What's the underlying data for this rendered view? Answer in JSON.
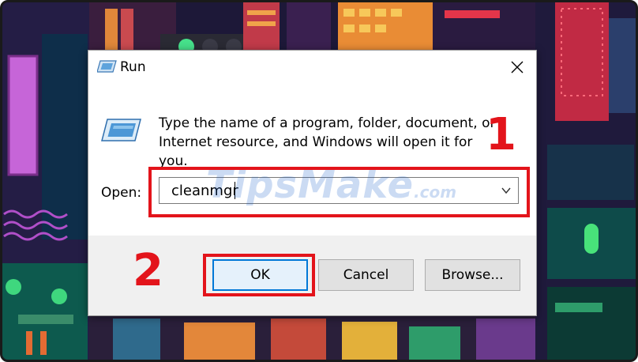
{
  "dialog": {
    "title": "Run",
    "description": "Type the name of a program, folder, document, or Internet resource, and Windows will open it for you.",
    "open_label": "Open:",
    "open_value": "cleanmgr",
    "buttons": {
      "ok": "OK",
      "cancel": "Cancel",
      "browse": "Browse..."
    }
  },
  "annotations": {
    "step1": "1",
    "step2": "2"
  },
  "watermark": {
    "brand": "TipsMake",
    "suffix": ".com"
  },
  "icons": {
    "title": "run-app-icon",
    "body": "run-app-icon-large",
    "close": "close-icon",
    "dropdown": "chevron-down-icon"
  },
  "colors": {
    "highlight": "#e3141b",
    "focus_border": "#0078d7",
    "footer": "#f0f0f0"
  }
}
